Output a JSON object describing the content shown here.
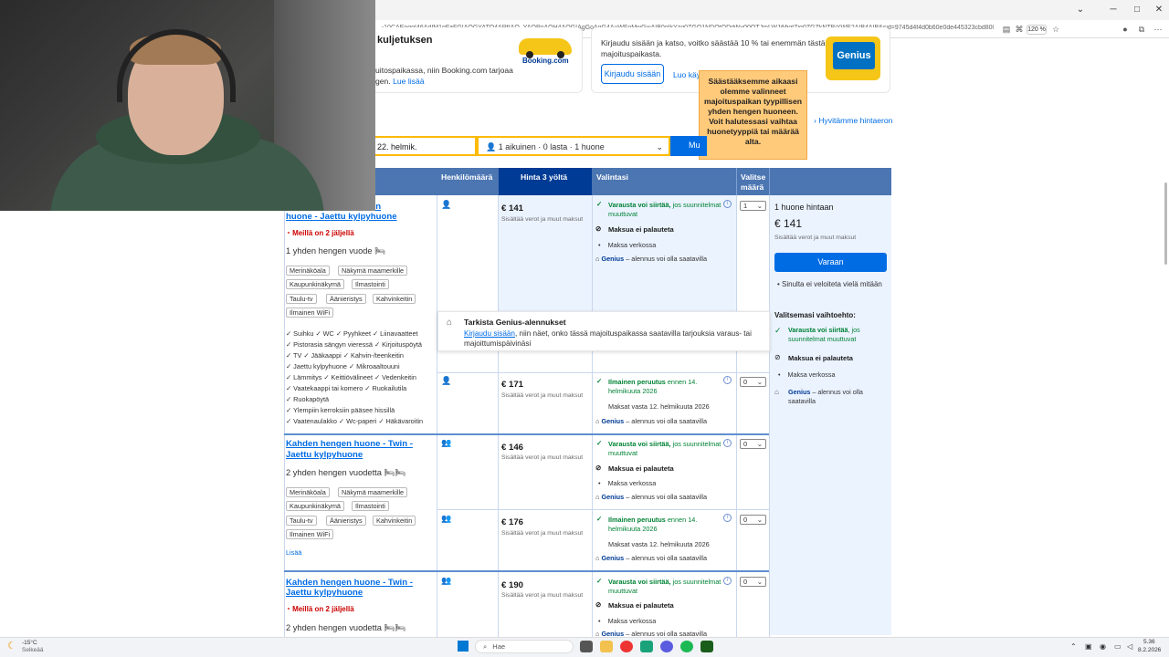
{
  "browser": {
    "url": "...-10CAEoggI46AdIM1gFaFGIAQGYATO4ARfIAQ_YAQPoAQH4AQGIAgGoAgG4AuWFoMwGwAIB0gIkYzg0ZGQ1NDQtODdjNy00OTJmLWJiMjgtZjg0ZGZkNTBjYWE2AIB4AIB&sid=9745d4f4d0b60e0de445323cbd800ba1&all_s...",
    "zoom": "120 %",
    "controls": {
      "minimize": "─",
      "maximize": "□",
      "close": "✕",
      "back": "‹"
    }
  },
  "top_banner": {
    "car_title": "kuljetuksen",
    "car_text_1": "uitospaikassa, niin Booking.com tarjoaa",
    "car_text_2": "gen.",
    "car_link": "Lue lisää",
    "booking_logo": "Booking.com",
    "genius_text_1": "Kirjaudu sisään ja katso, voitko säästää 10 % tai enemmän tästä",
    "genius_text_2": "majoituspaikasta.",
    "login_button": "Kirjaudu sisään",
    "read_more_partial": "Luo käy",
    "genius_logo": "Genius"
  },
  "tooltip": "Säästääksemme aikaasi olemme valinneet majoituspaikan tyypillisen yhden hengen huoneen. Voit halutessasi vaihtaa huonetyyppiä tai määrää alta.",
  "price_match": "Hyvitämme hintaeron",
  "search": {
    "dates": "22. helmik.",
    "guests": "1 aikuinen · 0 lasta · 1 huone",
    "button": "Mu"
  },
  "table_header": {
    "room_col": "",
    "guests": "Henkilömäärä",
    "price": "Hinta 3 yöltä",
    "choices": "Valintasi",
    "select_1": "Valitse",
    "select_2": "määrä"
  },
  "rooms": [
    {
      "title_1": "Yhden hengen",
      "title_1_partial": "gen",
      "title_2": "huone - Jaettu kylpyhuone",
      "scarcity": "Meillä on 2 jäljellä",
      "beds": "1 yhden hengen vuode",
      "chips": [
        "Merinäköala",
        "Näkymä maamerkille",
        "Kaupunkinäkymä",
        "Ilmastointi",
        "Taulu-tv",
        "Äänieristys",
        "Kahvinkeitin",
        "Ilmainen WiFi"
      ],
      "facilities": [
        [
          "Suihku",
          "WC",
          "Pyyhkeet",
          "Liinavaatteet"
        ],
        [
          "Pistorasia sängyn vieressä",
          "Kirjoituspöytä"
        ],
        [
          "TV",
          "Jääkaappi",
          "Kahvin-/teenkeitin"
        ],
        [
          "Jaettu kylpyhuone",
          "Mikroaaltouuni"
        ],
        [
          "Lämmitys",
          "Keittiövälineet",
          "Vedenkeitin"
        ],
        [
          "Vaatekaappi tai komero",
          "Ruokailutila"
        ],
        [
          "Ruokapöytä"
        ],
        [
          "Ylempiin kerroksiin pääsee hissillä"
        ],
        [
          "Vaatenaulakko",
          "Wc-paperi",
          "Häkävaroitin"
        ]
      ],
      "options": [
        {
          "price": "€ 141",
          "sub": "Sisältää verot ja muut maksut",
          "green": "Varausta voi siirtää",
          "green_tail": "jos suunnitelmat muuttuvat",
          "bold": "Maksua ei palauteta",
          "norm": "Maksa verkossa",
          "genius": "Genius",
          "genius_tail": "– alennus voi olla saatavilla",
          "qty": "1"
        },
        {
          "price": "€ 171",
          "sub": "Sisältää verot ja muut maksut",
          "green": "Ilmainen peruutus",
          "green_tail": "ennen 14. helmikuuta 2026",
          "norm": "Maksat vasta 12. helmikuuta 2026",
          "genius": "Genius",
          "genius_tail": "– alennus voi olla saatavilla",
          "qty": "0"
        }
      ]
    },
    {
      "title_1": "Kahden hengen huone - Twin -",
      "title_2": "Jaettu kylpyhuone",
      "beds": "2 yhden hengen vuodetta",
      "chips": [
        "Merinäköala",
        "Näkymä maamerkille",
        "Kaupunkinäkymä",
        "Ilmastointi",
        "Taulu-tv",
        "Äänieristys",
        "Kahvinkeitin",
        "Ilmainen WiFi"
      ],
      "more": "Lisää",
      "options": [
        {
          "price": "€ 146",
          "sub": "Sisältää verot ja muut maksut",
          "green": "Varausta voi siirtää",
          "green_tail": "jos suunnitelmat muuttuvat",
          "bold": "Maksua ei palauteta",
          "norm": "Maksa verkossa",
          "genius": "Genius",
          "genius_tail": "– alennus voi olla saatavilla",
          "qty": "0"
        },
        {
          "price": "€ 176",
          "sub": "Sisältää verot ja muut maksut",
          "green": "Ilmainen peruutus",
          "green_tail": "ennen 14. helmikuuta 2026",
          "norm": "Maksat vasta 12. helmikuuta 2026",
          "genius": "Genius",
          "genius_tail": "– alennus voi olla saatavilla",
          "qty": "0"
        }
      ]
    },
    {
      "title_1": "Kahden hengen huone - Twin -",
      "title_2": "Jaettu kylpyhuone",
      "scarcity": "Meillä on 2 jäljellä",
      "beds": "2 yhden hengen vuodetta",
      "options": [
        {
          "price": "€ 190",
          "sub": "Sisältää verot ja muut maksut",
          "green": "Varausta voi siirtää",
          "green_tail": "jos suunnitelmat muuttuvat",
          "bold": "Maksua ei palauteta",
          "norm": "Maksa verkossa",
          "genius": "Genius",
          "genius_tail": "– alennus voi olla saatavilla",
          "qty": "0"
        }
      ]
    }
  ],
  "genius_popup": {
    "title": "Tarkista Genius-alennukset",
    "link": "Kirjaudu sisään",
    "text": ", niin näet, onko tässä majoituspaikassa saatavilla tarjouksia varaus- tai majoittumispäivinäsi"
  },
  "reserve": {
    "rooms_for": "1 huone hintaan",
    "price": "€ 141",
    "sub": "Sisältää verot ja muut maksut",
    "button": "Varaan",
    "no_charge": "Sinulta ei veloiteta vielä mitään",
    "selected_title": "Valitsemasi vaihtoehto:",
    "green": "Varausta voi siirtää",
    "green_tail": "jos suunnitelmat muuttuvat",
    "bold": "Maksua ei palauteta",
    "norm": "Maksa verkossa",
    "genius": "Genius",
    "genius_tail": "– alennus voi olla saatavilla"
  },
  "taskbar": {
    "weather_temp": "-15°C",
    "weather_text": "Selkeää",
    "search": "Hae",
    "time": "5.36",
    "date": "8.2.2026"
  },
  "colors": {
    "booking_blue": "#006ce4",
    "header_blue": "#4c76b2",
    "dark_blue": "#003b95",
    "tooltip_orange": "#ffca7a",
    "green": "#008234",
    "red": "#c00"
  }
}
